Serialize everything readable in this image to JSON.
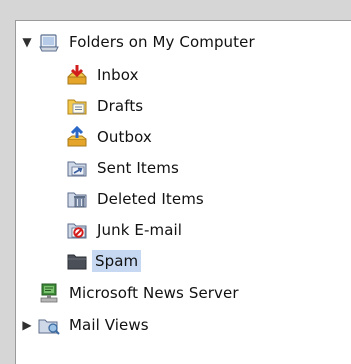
{
  "tree": {
    "root": {
      "label": "Folders on My Computer",
      "expanded": true,
      "children": [
        {
          "label": "Inbox",
          "icon": "inbox-icon"
        },
        {
          "label": "Drafts",
          "icon": "drafts-icon"
        },
        {
          "label": "Outbox",
          "icon": "outbox-icon"
        },
        {
          "label": "Sent Items",
          "icon": "sent-items-icon"
        },
        {
          "label": "Deleted Items",
          "icon": "deleted-items-icon"
        },
        {
          "label": "Junk E-mail",
          "icon": "junk-email-icon"
        },
        {
          "label": "Spam",
          "icon": "folder-icon",
          "selected": true
        }
      ]
    },
    "news_server": {
      "label": "Microsoft News Server",
      "icon": "news-server-icon"
    },
    "mail_views": {
      "label": "Mail Views",
      "expanded": false,
      "icon": "mail-views-icon"
    }
  },
  "colors": {
    "selection": "#c7d9f2",
    "panel": "#ffffff",
    "background": "#d6d6d6"
  }
}
